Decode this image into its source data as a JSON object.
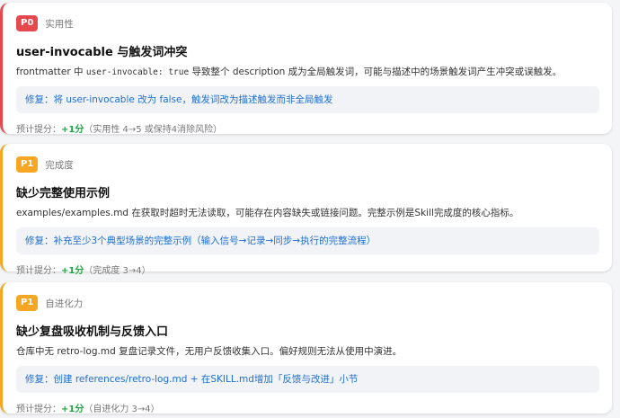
{
  "colors": {
    "p0_accent": "#e5484d",
    "p1_accent": "#f5a623",
    "fix_text": "#1f6fd1",
    "gain_text": "#22a447"
  },
  "cards": [
    {
      "priority": "P0",
      "category": "实用性",
      "title": "user-invocable 与触发词冲突",
      "desc_pre": "frontmatter 中 ",
      "desc_code": "user-invocable: true",
      "desc_post": " 导致整个 description 成为全局触发词，可能与描述中的场景触发词产生冲突或误触发。",
      "fix": "修复：将 user-invocable 改为 false，触发词改为描述触发而非全局触发",
      "gain_label": "预计提分：",
      "gain_points": "+1分",
      "gain_note": "（实用性 4→5 或保持4消除风险）"
    },
    {
      "priority": "P1",
      "category": "完成度",
      "title": "缺少完整使用示例",
      "desc": "examples/examples.md 在获取时超时无法读取，可能存在内容缺失或链接问题。完整示例是Skill完成度的核心指标。",
      "fix": "修复：补充至少3个典型场景的完整示例（输入信号→记录→同步→执行的完整流程）",
      "gain_label": "预计提分：",
      "gain_points": "+1分",
      "gain_note": "（完成度 3→4）"
    },
    {
      "priority": "P1",
      "category": "自进化力",
      "title": "缺少复盘吸收机制与反馈入口",
      "desc": "仓库中无 retro-log.md 复盘记录文件，无用户反馈收集入口。偏好规则无法从使用中演进。",
      "fix": "修复：创建 references/retro-log.md + 在SKILL.md增加「反馈与改进」小节",
      "gain_label": "预计提分：",
      "gain_points": "+1分",
      "gain_note": "（自进化力 3→4）"
    }
  ]
}
